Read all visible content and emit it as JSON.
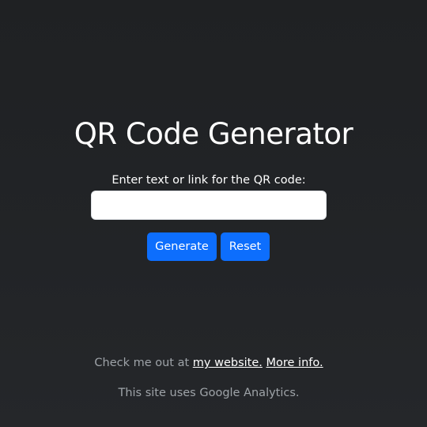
{
  "header": {
    "title": "QR Code Generator"
  },
  "form": {
    "label": "Enter text or link for the QR code:",
    "input_value": "",
    "input_placeholder": "",
    "generate_label": "Generate",
    "reset_label": "Reset"
  },
  "footer": {
    "prefix": "Check me out at ",
    "website_link": "my website.",
    "more_info_link": "More info.",
    "analytics_note": "This site uses Google Analytics."
  },
  "colors": {
    "background": "#222427",
    "accent": "#0d6efd",
    "muted_text": "#9ea3a8"
  }
}
